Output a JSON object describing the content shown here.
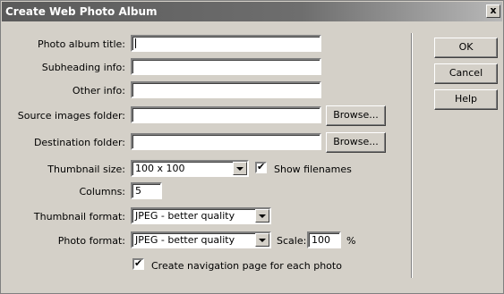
{
  "dialog": {
    "title": "Create Web Photo Album",
    "close_glyph": "x"
  },
  "form": {
    "album_title": {
      "label": "Photo album title:",
      "value": ""
    },
    "subheading": {
      "label": "Subheading info:",
      "value": ""
    },
    "other_info": {
      "label": "Other info:",
      "value": ""
    },
    "source_folder": {
      "label": "Source images folder:",
      "value": "",
      "browse": "Browse..."
    },
    "destination_folder": {
      "label": "Destination folder:",
      "value": "",
      "browse": "Browse..."
    },
    "thumbnail_size": {
      "label": "Thumbnail size:",
      "value": "100 x 100"
    },
    "show_filenames": {
      "label": "Show filenames",
      "checked": true
    },
    "columns": {
      "label": "Columns:",
      "value": "5"
    },
    "thumbnail_format": {
      "label": "Thumbnail format:",
      "value": "JPEG - better quality"
    },
    "photo_format": {
      "label": "Photo format:",
      "value": "JPEG - better quality"
    },
    "scale": {
      "label": "Scale:",
      "value": "100",
      "unit": "%"
    },
    "create_nav": {
      "label": "Create navigation page for each photo",
      "checked": true
    }
  },
  "buttons": {
    "ok": "OK",
    "cancel": "Cancel",
    "help": "Help"
  },
  "icons": {
    "dropdown": "chevron-down-icon",
    "check": "check-icon",
    "close": "close-icon"
  }
}
